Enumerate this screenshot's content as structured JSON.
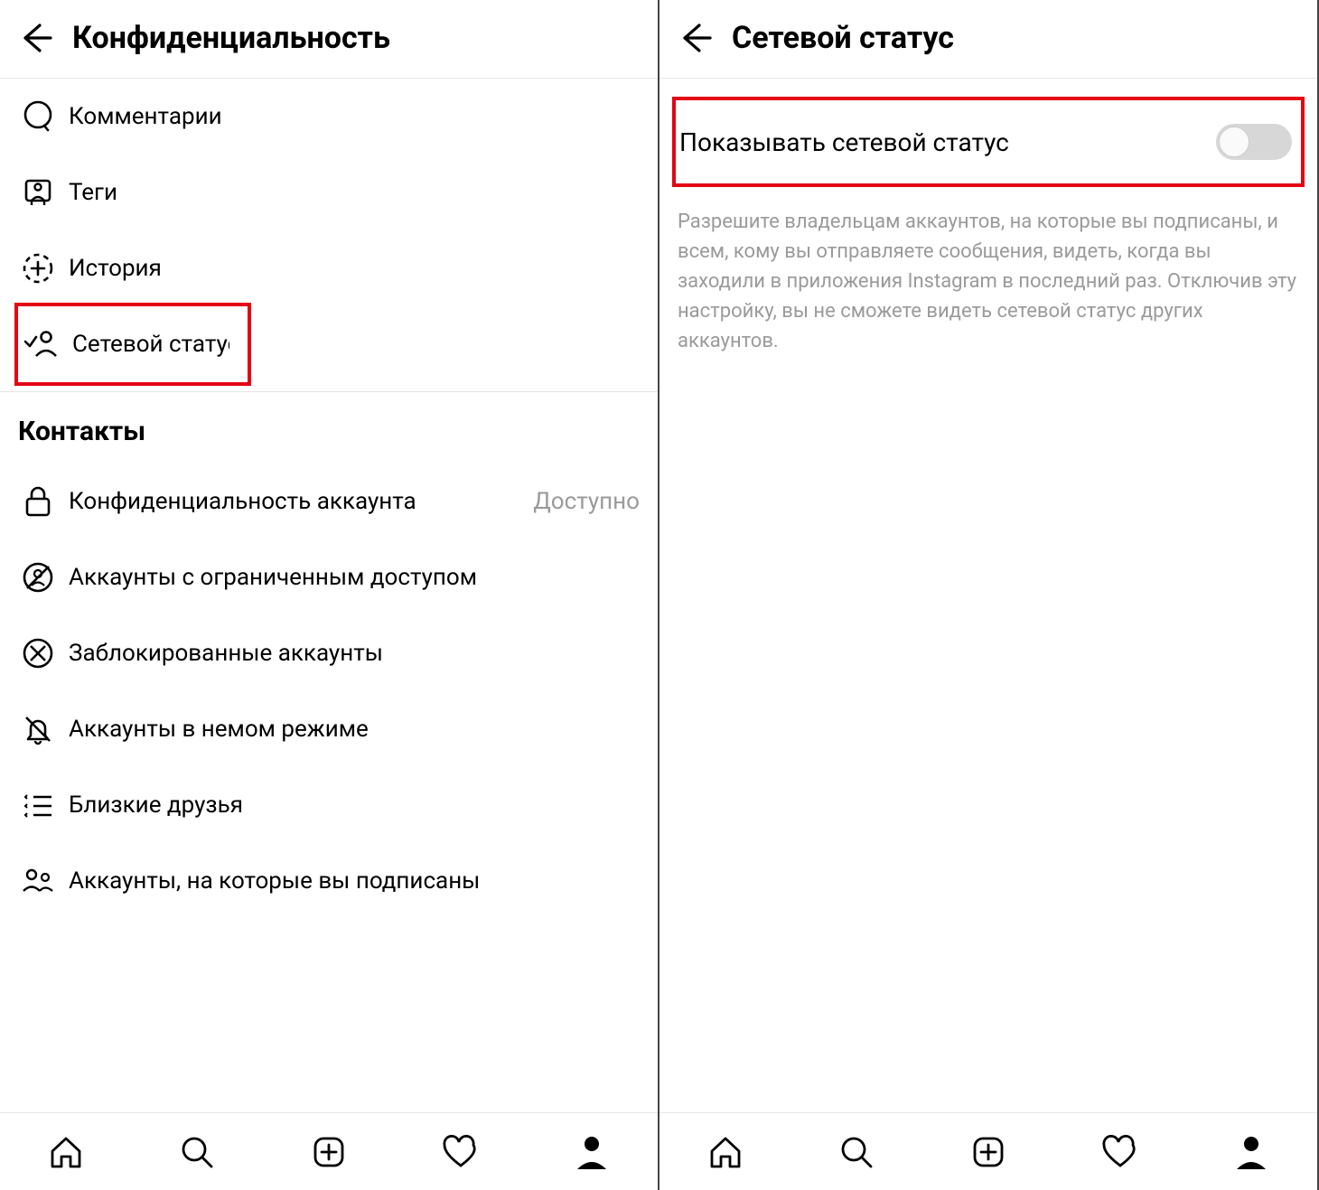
{
  "left": {
    "title": "Конфиденциальность",
    "items": [
      {
        "label": "Комментарии"
      },
      {
        "label": "Теги"
      },
      {
        "label": "История"
      },
      {
        "label": "Сетевой статус"
      }
    ],
    "section_header": "Контакты",
    "contacts": [
      {
        "label": "Конфиденциальность аккаунта",
        "trailing": "Доступно"
      },
      {
        "label": "Аккаунты с ограниченным доступом"
      },
      {
        "label": "Заблокированные аккаунты"
      },
      {
        "label": "Аккаунты в немом режиме"
      },
      {
        "label": "Близкие друзья"
      },
      {
        "label": "Аккаунты, на которые вы подписаны"
      }
    ]
  },
  "right": {
    "title": "Сетевой статус",
    "toggle_label": "Показывать сетевой статус",
    "description": "Разрешите владельцам аккаунтов, на которые вы подписаны, и всем, кому вы отправляете сообщения, видеть, когда вы заходили в приложения Instagram в последний раз. Отключив эту настройку, вы не сможете видеть сетевой статус других аккаунтов."
  },
  "nav": {
    "home": "home",
    "search": "search",
    "add": "add",
    "activity": "activity",
    "profile": "profile"
  }
}
